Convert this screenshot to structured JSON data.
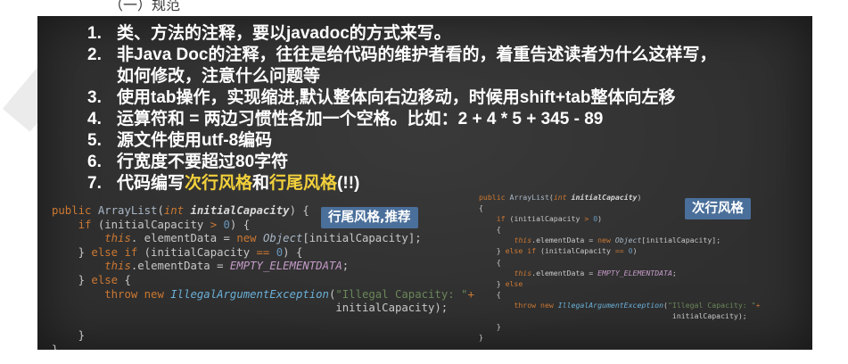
{
  "page": {
    "header_text": "（一）规范"
  },
  "rules": [
    {
      "num": "1.",
      "text": "类、方法的注释，要以javadoc的方式来写。"
    },
    {
      "num": "2.",
      "text": "非Java Doc的注释，往往是给代码的维护者看的，着重告述读者为什么这样写，"
    },
    {
      "num": "",
      "text": "如何修改，注意什么问题等"
    },
    {
      "num": "3.",
      "text": "使用tab操作，实现缩进,默认整体向右边移动，时候用shift+tab整体向左移"
    },
    {
      "num": "4.",
      "text": "运算符和 = 两边习惯性各加一个空格。比如：2 + 4 * 5 + 345 - 89"
    },
    {
      "num": "5.",
      "text": "源文件使用utf-8编码"
    },
    {
      "num": "6.",
      "text": "行宽度不要超过80字符"
    },
    {
      "num": "7.",
      "text_prefix": "代码编写",
      "hl1": "次行风格",
      "mid": "和",
      "hl2": "行尾风格",
      "suffix": "(!!)"
    }
  ],
  "labels": {
    "left": "行尾风格,推荐",
    "right": "次行风格"
  },
  "code_left": [
    [
      [
        "kw",
        "public "
      ],
      [
        "cls",
        "ArrayList"
      ],
      [
        "",
        "("
      ],
      [
        "kw-i",
        "int "
      ],
      [
        "par",
        "initialCapacity"
      ],
      [
        "",
        ") {"
      ]
    ],
    [
      [
        "",
        "    "
      ],
      [
        "kw",
        "if "
      ],
      [
        "",
        "(initialCapacity "
      ],
      [
        "kw",
        "> "
      ],
      [
        "nm",
        "0"
      ],
      [
        "",
        ") {"
      ]
    ],
    [
      [
        "",
        "        "
      ],
      [
        "th",
        "this"
      ],
      [
        "",
        ". elementData = "
      ],
      [
        "kw",
        "new "
      ],
      [
        "cls-i",
        "Object"
      ],
      [
        "",
        "[initialCapacity];"
      ]
    ],
    [
      [
        "",
        "    } "
      ],
      [
        "kw",
        "else if "
      ],
      [
        "",
        "(initialCapacity "
      ],
      [
        "kw",
        "== "
      ],
      [
        "nm",
        "0"
      ],
      [
        "",
        ") {"
      ]
    ],
    [
      [
        "",
        "        "
      ],
      [
        "th",
        "this"
      ],
      [
        "",
        ".elementData = "
      ],
      [
        "cst",
        "EMPTY_ELEMENTDATA"
      ],
      [
        "",
        ";"
      ]
    ],
    [
      [
        "",
        "    } "
      ],
      [
        "kw",
        "else "
      ],
      [
        "",
        "{"
      ]
    ],
    [
      [
        "",
        "        "
      ],
      [
        "kw",
        "throw new "
      ],
      [
        "exc",
        "IllegalArgumentException"
      ],
      [
        "",
        "("
      ],
      [
        "str",
        "\"Illegal Capacity: \""
      ],
      [
        "kw",
        "+"
      ]
    ],
    [
      [
        "",
        "                                           initialCapacity);"
      ]
    ],
    [
      [
        "",
        ""
      ]
    ],
    [
      [
        "",
        "    }"
      ]
    ],
    [
      [
        "",
        "}"
      ]
    ]
  ],
  "code_right": [
    [
      [
        "kw",
        "public "
      ],
      [
        "cls",
        "ArrayList"
      ],
      [
        "",
        "("
      ],
      [
        "kw-i",
        "int "
      ],
      [
        "par",
        "initialCapacity"
      ],
      [
        "",
        ")"
      ]
    ],
    [
      [
        "",
        "{"
      ]
    ],
    [
      [
        "",
        "    "
      ],
      [
        "kw",
        "if "
      ],
      [
        "",
        "(initialCapacity "
      ],
      [
        "kw",
        "> "
      ],
      [
        "nm",
        "0"
      ],
      [
        "",
        ")"
      ]
    ],
    [
      [
        "",
        "    {"
      ]
    ],
    [
      [
        "",
        "        "
      ],
      [
        "th",
        "this"
      ],
      [
        "",
        ".elementData = "
      ],
      [
        "kw",
        "new "
      ],
      [
        "cls-i",
        "Object"
      ],
      [
        "",
        "[initialCapacity];"
      ]
    ],
    [
      [
        "",
        "    } "
      ],
      [
        "kw",
        "else if "
      ],
      [
        "",
        "(initialCapacity "
      ],
      [
        "kw",
        "== "
      ],
      [
        "nm",
        "0"
      ],
      [
        "",
        ")"
      ]
    ],
    [
      [
        "",
        "    {"
      ]
    ],
    [
      [
        "",
        "        "
      ],
      [
        "th",
        "this"
      ],
      [
        "",
        ".elementData = "
      ],
      [
        "cst",
        "EMPTY_ELEMENTDATA"
      ],
      [
        "",
        ";"
      ]
    ],
    [
      [
        "",
        "    } "
      ],
      [
        "kw",
        "else"
      ]
    ],
    [
      [
        "",
        "    {"
      ]
    ],
    [
      [
        "",
        "        "
      ],
      [
        "kw",
        "throw new "
      ],
      [
        "exc",
        "IllegalArgumentException"
      ],
      [
        "",
        "("
      ],
      [
        "str",
        "\"Illegal Capacity: \""
      ],
      [
        "kw",
        "+"
      ]
    ],
    [
      [
        "",
        "                                            initialCapacity);"
      ]
    ],
    [
      [
        "",
        "    }"
      ]
    ],
    [
      [
        "",
        "}"
      ]
    ]
  ]
}
